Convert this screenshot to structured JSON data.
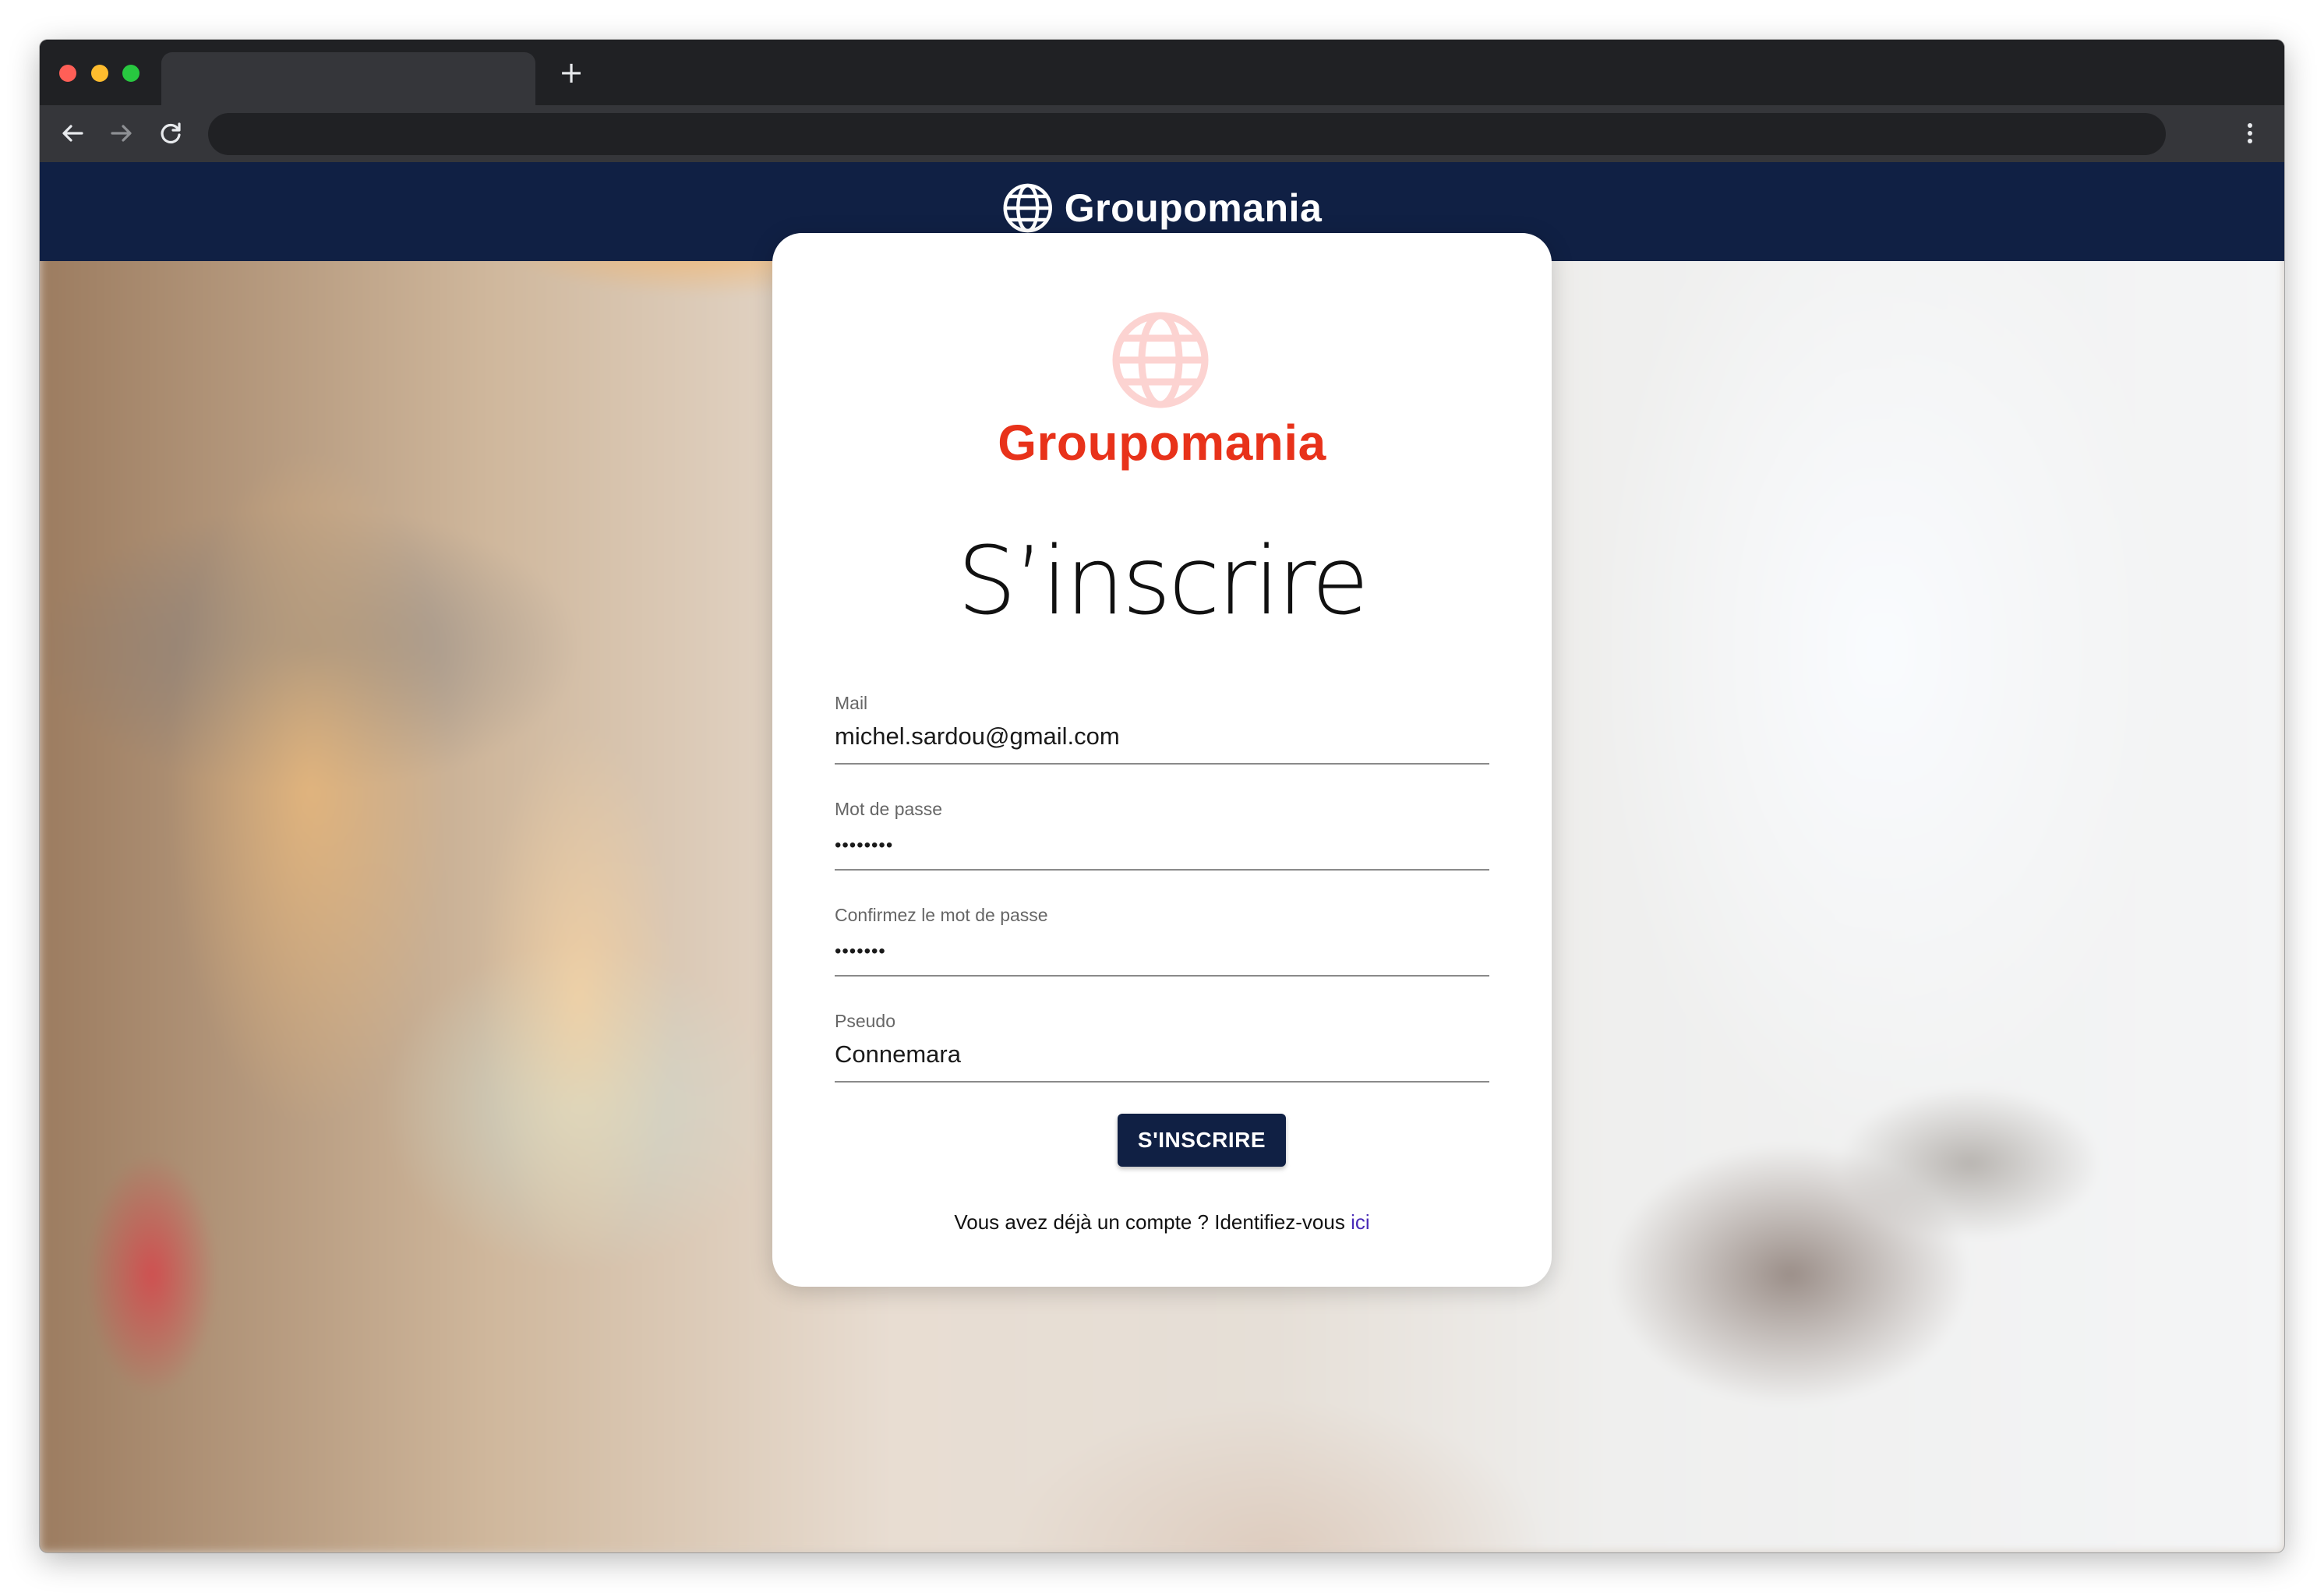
{
  "browser": {
    "tab_title": "",
    "address": "",
    "new_tab_symbol": "+"
  },
  "header": {
    "brand": "Groupomania"
  },
  "card": {
    "logo_text": "Groupomania",
    "title": "S’inscrire",
    "fields": [
      {
        "label": "Mail",
        "value": "michel.sardou@gmail.com",
        "type": "email"
      },
      {
        "label": "Mot de passe",
        "value": "••••••••",
        "type": "password"
      },
      {
        "label": "Confirmez le mot de passe",
        "value": "•••••••",
        "type": "password"
      },
      {
        "label": "Pseudo",
        "value": "Connemara",
        "type": "text"
      }
    ],
    "submit_label": "S'INSCRIRE",
    "login_prompt": "Vous avez déjà un compte ? Identifiez-vous ",
    "login_link": "ici"
  },
  "colors": {
    "header_bg": "#102044",
    "brand_red": "#e8321a",
    "button_bg": "#102044",
    "link": "#4a2bb8"
  },
  "icons": {
    "header_logo": "globe-icon",
    "card_logo": "globe-icon"
  }
}
